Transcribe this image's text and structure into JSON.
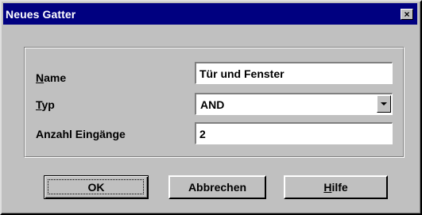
{
  "window": {
    "title": "Neues Gatter",
    "close_symbol": "×"
  },
  "form": {
    "name": {
      "label_prefix": "",
      "label_mnemonic": "N",
      "label_rest": "ame",
      "value": "Tür und Fenster"
    },
    "type": {
      "label_prefix": "",
      "label_mnemonic": "T",
      "label_rest": "yp",
      "value": "AND"
    },
    "inputs": {
      "label_prefix": "Anzahl Ein",
      "label_mnemonic": "g",
      "label_rest": "änge",
      "value": "2"
    }
  },
  "buttons": {
    "ok_label": "OK",
    "cancel_label": "Abbrechen",
    "help_prefix": "",
    "help_mnemonic": "H",
    "help_rest": "ilfe"
  },
  "icons": {
    "close": "close-icon",
    "dropdown": "chevron-down-icon"
  },
  "colors": {
    "titlebar": "#000080",
    "face": "#c0c0c0"
  }
}
